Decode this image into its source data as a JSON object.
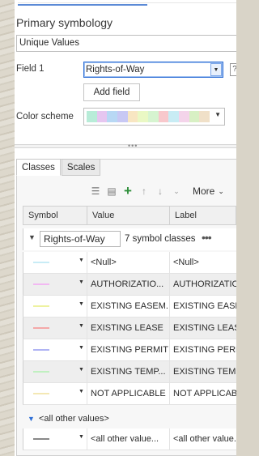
{
  "symbology": {
    "section_title": "Primary symbology",
    "renderer": "Unique Values",
    "field1_label": "Field 1",
    "field1_value": "Rights-of-Way",
    "field_dropdown_glyph": "▼",
    "help_glyph": "?",
    "add_field_label": "Add field",
    "color_scheme_label": "Color scheme",
    "color_scheme_colors": [
      "#b8ecd8",
      "#e6c6f0",
      "#b8d8f4",
      "#c8c8f4",
      "#f8e6c2",
      "#eaf8c4",
      "#d6f4d0",
      "#f8c8cc",
      "#c8ecf4",
      "#f4d4ea",
      "#d8f0c4",
      "#f0e0c8"
    ]
  },
  "tabs": [
    {
      "label": "Classes"
    },
    {
      "label": "Scales"
    }
  ],
  "toolbar": {
    "more_label": "More",
    "more_chevron": "⌄",
    "icons": [
      "table-icon",
      "add-classes-icon",
      "add-icon",
      "move-up-icon",
      "move-down-icon",
      "sort-icon"
    ]
  },
  "grid": {
    "columns": [
      "Symbol",
      "Value",
      "Label"
    ],
    "group": {
      "field": "Rights-of-Way",
      "count_text": "7 symbol classes",
      "more_glyph": "•••"
    },
    "rows": [
      {
        "color": "#c8ecf6",
        "value": "<Null>",
        "label": "<Null>"
      },
      {
        "color": "#f2b8f2",
        "value": "AUTHORIZATIO...",
        "label": "AUTHORIZATIO..."
      },
      {
        "color": "#eef2a0",
        "value": "EXISTING EASEM...",
        "label": "EXISTING EASEM..."
      },
      {
        "color": "#f4a8a8",
        "value": "EXISTING LEASE",
        "label": "EXISTING LEASE"
      },
      {
        "color": "#b0b4f4",
        "value": "EXISTING PERMIT",
        "label": "EXISTING PERMIT"
      },
      {
        "color": "#c0f0c0",
        "value": "EXISTING TEMP...",
        "label": "EXISTING TEMP..."
      },
      {
        "color": "#f4e8b4",
        "value": "NOT APPLICABLE",
        "label": "NOT APPLICABLE"
      }
    ],
    "other": {
      "group_label": "<all other values>",
      "color": "#888888",
      "value": "<all other value...",
      "label": "<all other value..."
    }
  }
}
